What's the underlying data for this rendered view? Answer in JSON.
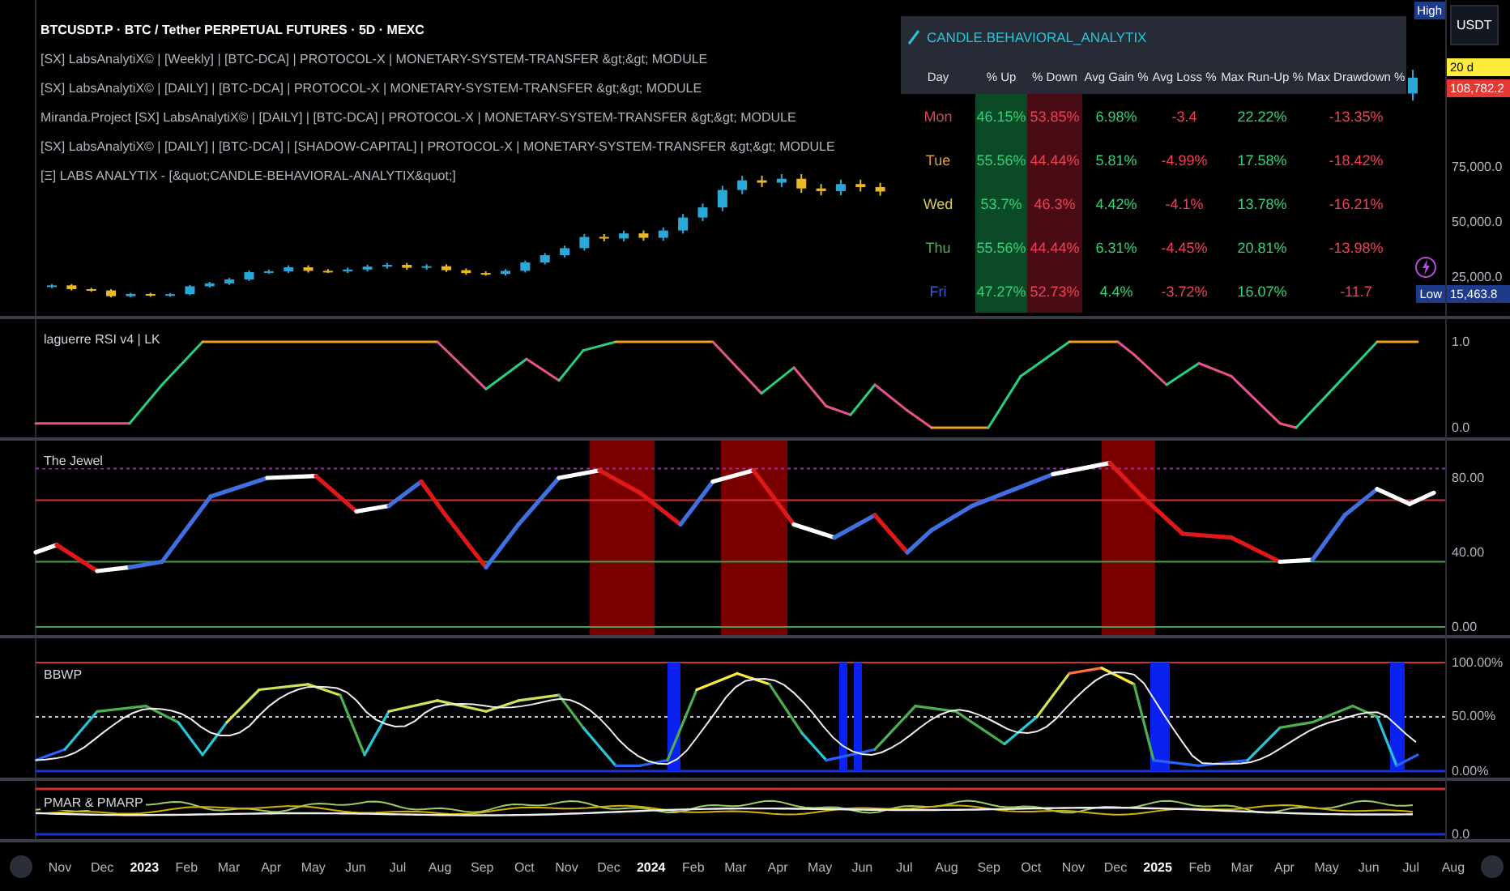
{
  "legend": {
    "symbol_line": "BTCUSDT.P · BTC / Tether PERPETUAL FUTURES · 5D · MEXC",
    "indicators": [
      "[SX]  LabsAnalytiX© | [Weekly] | [BTC-DCA] | PROTOCOL-X | MONETARY-SYSTEM-TRANSFER &gt;&gt; MODULE",
      "[SX]  LabsAnalytiX© | [DAILY] | [BTC-DCA] | PROTOCOL-X | MONETARY-SYSTEM-TRANSFER &gt;&gt; MODULE",
      "Miranda.Project [SX]  LabsAnalytiX© | [DAILY] | [BTC-DCA] | PROTOCOL-X | MONETARY-SYSTEM-TRANSFER &gt;&gt; MODULE",
      "[SX]  LabsAnalytiX© | [DAILY] | [BTC-DCA] | [SHADOW-CAPITAL] | PROTOCOL-X | MONETARY-SYSTEM-TRANSFER &gt;&gt; MODULE",
      "[Ξ] LABS ANALYTIX - [&quot;CANDLE-BEHAVIORAL-ANALYTIX&quot;]"
    ]
  },
  "price_chart": {
    "chart_data": {
      "type": "candlestick",
      "categories": [
        null,
        null,
        null,
        null,
        null,
        null,
        null,
        null,
        null,
        null,
        null,
        null,
        null,
        null,
        null,
        null,
        null,
        null,
        null,
        null,
        null,
        null,
        null,
        null,
        null,
        null,
        null,
        null,
        null,
        null,
        null,
        null,
        null,
        null,
        null,
        null,
        null,
        null,
        null,
        null,
        null,
        null,
        null,
        null,
        null,
        null,
        null,
        null,
        null,
        null,
        null,
        null,
        null,
        null,
        null,
        null,
        null,
        null,
        null,
        null,
        null,
        null,
        null,
        null,
        null,
        null,
        null,
        null,
        null,
        null
      ],
      "ohlc": [
        [
          20500,
          21800,
          19900,
          21200
        ],
        [
          21200,
          21800,
          18900,
          19500
        ],
        [
          19500,
          20100,
          18300,
          18900
        ],
        [
          18900,
          19500,
          15800,
          16300
        ],
        [
          16300,
          17800,
          15800,
          17300
        ],
        [
          17300,
          17800,
          16100,
          16600
        ],
        [
          16600,
          17700,
          16100,
          17200
        ],
        [
          17200,
          21400,
          16700,
          20800
        ],
        [
          20800,
          22800,
          20200,
          22100
        ],
        [
          22100,
          24600,
          21400,
          23900
        ],
        [
          23900,
          28000,
          23200,
          27200
        ],
        [
          27200,
          28400,
          26400,
          27600
        ],
        [
          27600,
          30300,
          26800,
          29400
        ],
        [
          29400,
          30300,
          27000,
          27800
        ],
        [
          27800,
          28600,
          26800,
          27600
        ],
        [
          27600,
          29300,
          26800,
          28400
        ],
        [
          28400,
          30600,
          27500,
          29700
        ],
        [
          29700,
          31400,
          28800,
          30500
        ],
        [
          30500,
          31400,
          28300,
          29200
        ],
        [
          29200,
          30800,
          28300,
          29900
        ],
        [
          29900,
          30800,
          27300,
          28100
        ],
        [
          28100,
          28900,
          26000,
          26800
        ],
        [
          26800,
          27600,
          25600,
          26400
        ],
        [
          26400,
          28600,
          25600,
          27800
        ],
        [
          27800,
          32500,
          27000,
          31600
        ],
        [
          31600,
          35900,
          30700,
          34900
        ],
        [
          34900,
          39200,
          33900,
          38100
        ],
        [
          38100,
          44500,
          37000,
          43200
        ],
        [
          43200,
          44500,
          41200,
          42500
        ],
        [
          42500,
          46100,
          41200,
          44800
        ],
        [
          44800,
          46100,
          41500,
          42800
        ],
        [
          42800,
          47500,
          41500,
          46100
        ],
        [
          46100,
          53600,
          44700,
          52000
        ],
        [
          52000,
          58300,
          50400,
          56600
        ],
        [
          56600,
          66400,
          54900,
          64500
        ],
        [
          64500,
          71000,
          62600,
          68900
        ],
        [
          68900,
          71000,
          65800,
          67800
        ],
        [
          67800,
          71700,
          65800,
          69600
        ],
        [
          69600,
          71700,
          63200,
          65200
        ],
        [
          65200,
          67200,
          62100,
          64000
        ],
        [
          64000,
          69200,
          62100,
          67200
        ],
        [
          67200,
          69200,
          63800,
          65800
        ],
        [
          65800,
          67800,
          61900,
          63800
        ],
        null,
        null,
        null,
        null,
        null,
        null,
        null,
        null,
        null,
        null,
        null,
        null,
        null,
        null,
        null,
        null,
        null,
        null,
        null,
        null,
        null,
        null,
        null,
        null,
        null,
        null,
        [
          108300,
          119000,
          105100,
          115500
        ]
      ],
      "ylim": [
        7353,
        150735
      ],
      "yticks": [
        {
          "value": 75000,
          "label": "75,000.0"
        },
        {
          "value": 50000,
          "label": "50,000.0"
        },
        {
          "value": 25000,
          "label": "25,000.0"
        }
      ]
    }
  },
  "table": {
    "title": "CANDLE.BEHAVIORAL_ANALYTIX",
    "columns": [
      {
        "label": "Day",
        "kind": "plain"
      },
      {
        "label": "% Up",
        "kind": "upshade"
      },
      {
        "label": "% Down",
        "kind": "downshade"
      },
      {
        "label": "Avg Gain %",
        "kind": "up"
      },
      {
        "label": "Avg Loss %",
        "kind": "down"
      },
      {
        "label": "Max Run-Up %",
        "kind": "up"
      },
      {
        "label": "Max Drawdown %",
        "kind": "down"
      }
    ],
    "rows": [
      {
        "color": "#d94455",
        "cells": [
          "Mon",
          "46.15%",
          "53.85%",
          "6.98%",
          "-3.4",
          "22.22%",
          "-13.35%"
        ]
      },
      {
        "color": "#e09a3a",
        "cells": [
          "Tue",
          "55.56%",
          "44.44%",
          "5.81%",
          "-4.99%",
          "17.58%",
          "-18.42%"
        ]
      },
      {
        "color": "#d9c94a",
        "cells": [
          "Wed",
          "53.7%",
          "46.3%",
          "4.42%",
          "-4.1%",
          "13.78%",
          "-16.21%"
        ]
      },
      {
        "color": "#4caf50",
        "cells": [
          "Thu",
          "55.56%",
          "44.44%",
          "6.31%",
          "-4.45%",
          "20.81%",
          "-13.98%"
        ]
      },
      {
        "color": "#3d5bd9",
        "cells": [
          "Fri",
          "47.27%",
          "52.73%",
          "4.4%",
          "-3.72%",
          "16.07%",
          "-11.7"
        ]
      }
    ]
  },
  "price_axis": {
    "currency": "USDT",
    "high_tag": "High",
    "countdown": "20 d",
    "last_price": "108,782.2",
    "low_tag": "Low",
    "low_price": "15,463.8"
  },
  "panels": [
    {
      "title": "laguerre RSI v4 | LK",
      "ticks": [
        "1.0",
        "0.0"
      ]
    },
    {
      "title": "The Jewel",
      "ticks": [
        "80.00",
        "40.00",
        "0.00"
      ]
    },
    {
      "title": "BBWP",
      "ticks": [
        "100.00%",
        "50.00%",
        "0.00%"
      ]
    },
    {
      "title": "PMAR & PMARP",
      "ticks": [
        "0.0"
      ]
    }
  ],
  "time_axis": [
    {
      "label": "Nov",
      "kind": "month"
    },
    {
      "label": "Dec",
      "kind": "month"
    },
    {
      "label": "2023",
      "kind": "year"
    },
    {
      "label": "Feb",
      "kind": "month"
    },
    {
      "label": "Mar",
      "kind": "month"
    },
    {
      "label": "Apr",
      "kind": "month"
    },
    {
      "label": "May",
      "kind": "month"
    },
    {
      "label": "Jun",
      "kind": "month"
    },
    {
      "label": "Jul",
      "kind": "month"
    },
    {
      "label": "Aug",
      "kind": "month"
    },
    {
      "label": "Sep",
      "kind": "month"
    },
    {
      "label": "Oct",
      "kind": "month"
    },
    {
      "label": "Nov",
      "kind": "month"
    },
    {
      "label": "Dec",
      "kind": "month"
    },
    {
      "label": "2024",
      "kind": "year"
    },
    {
      "label": "Feb",
      "kind": "month"
    },
    {
      "label": "Mar",
      "kind": "month"
    },
    {
      "label": "Apr",
      "kind": "month"
    },
    {
      "label": "May",
      "kind": "month"
    },
    {
      "label": "Jun",
      "kind": "month"
    },
    {
      "label": "Jul",
      "kind": "month"
    },
    {
      "label": "Aug",
      "kind": "month"
    },
    {
      "label": "Sep",
      "kind": "month"
    },
    {
      "label": "Oct",
      "kind": "month"
    },
    {
      "label": "Nov",
      "kind": "month"
    },
    {
      "label": "Dec",
      "kind": "month"
    },
    {
      "label": "2025",
      "kind": "year"
    },
    {
      "label": "Feb",
      "kind": "month"
    },
    {
      "label": "Mar",
      "kind": "month"
    },
    {
      "label": "Apr",
      "kind": "month"
    },
    {
      "label": "May",
      "kind": "month"
    },
    {
      "label": "Jun",
      "kind": "month"
    },
    {
      "label": "Jul",
      "kind": "month"
    },
    {
      "label": "Aug",
      "kind": "month"
    }
  ]
}
